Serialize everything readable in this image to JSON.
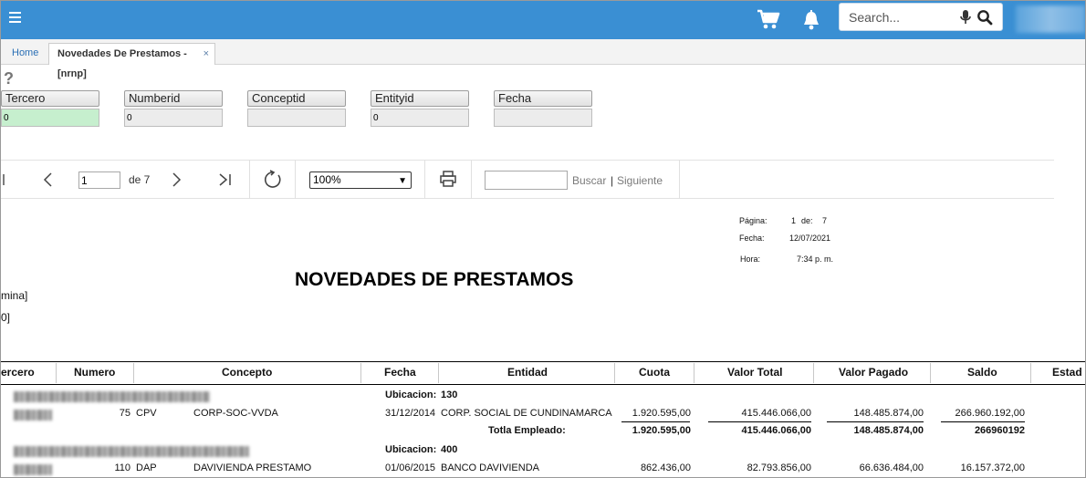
{
  "header": {
    "search_placeholder": "Search...",
    "accent_color": "#3a8fd3",
    "icons": [
      "menu-icon",
      "cart-icon",
      "bell-icon",
      "microphone-icon",
      "search-icon"
    ]
  },
  "tabs": {
    "home": "Home",
    "active": "Novedades De Prestamos -[nrnp]",
    "close": "×"
  },
  "help": "?",
  "params": [
    {
      "label": "Tercero",
      "value": "0"
    },
    {
      "label": "Numberid",
      "value": "0"
    },
    {
      "label": "Conceptid",
      "value": ""
    },
    {
      "label": "Entityid",
      "value": "0"
    },
    {
      "label": "Fecha",
      "value": ""
    }
  ],
  "toolbar": {
    "page_value": "1",
    "of_text": "de 7",
    "zoom": "100%",
    "find_value": "",
    "find_label": "Buscar",
    "separator": "|",
    "next_label": "Siguiente"
  },
  "report": {
    "meta": {
      "page_label": "Página:",
      "page_value": "1",
      "of_label": "de:",
      "of_value": "7",
      "date_label": "Fecha:",
      "date_value": "12/07/2021",
      "time_label": "Hora:",
      "time_value": "7:34 p. m."
    },
    "title": "NOVEDADES DE PRESTAMOS",
    "cut_line1": "mina]",
    "cut_line2": "0]",
    "columns": [
      "ercero",
      "Numero",
      "Concepto",
      "Fecha",
      "Entidad",
      "Cuota",
      "Valor Total",
      "Valor Pagado",
      "Saldo",
      "Estad"
    ],
    "groups": [
      {
        "location_label": "Ubicacion:",
        "location_value": "130",
        "row": {
          "numero": "75",
          "concepto_code": "CPV",
          "concepto": "CORP-SOC-VVDA",
          "fecha": "31/12/2014",
          "entidad": "CORP. SOCIAL DE CUNDINAMARCA",
          "cuota": "1.920.595,00",
          "valor_total": "415.446.066,00",
          "valor_pagado": "148.485.874,00",
          "saldo": "266.960.192,00"
        },
        "total": {
          "label": "Totla Empleado:",
          "cuota": "1.920.595,00",
          "valor_total": "415.446.066,00",
          "valor_pagado": "148.485.874,00",
          "saldo": "266960192"
        }
      },
      {
        "location_label": "Ubicacion:",
        "location_value": "400",
        "row": {
          "numero": "110",
          "concepto_code": "DAP",
          "concepto": "DAVIVIENDA PRESTAMO",
          "fecha": "01/06/2015",
          "entidad": "BANCO DAVIVIENDA",
          "cuota": "862.436,00",
          "valor_total": "82.793.856,00",
          "valor_pagado": "66.636.484,00",
          "saldo": "16.157.372,00"
        }
      }
    ]
  }
}
